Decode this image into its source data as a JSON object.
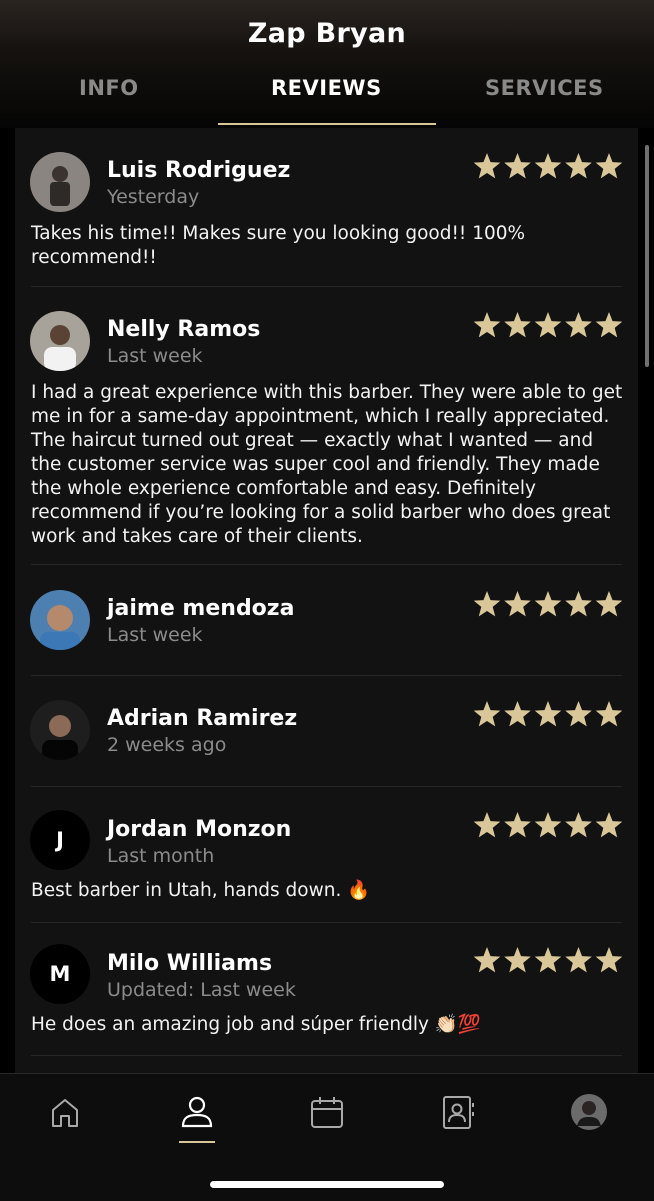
{
  "header": {
    "title": "Zap Bryan"
  },
  "tabs": [
    {
      "label": "INFO"
    },
    {
      "label": "REVIEWS"
    },
    {
      "label": "SERVICES"
    }
  ],
  "reviews": [
    {
      "name": "Luis Rodriguez",
      "time": "Yesterday",
      "rating": 5,
      "text": "Takes his time!! Makes sure you looking good!! 100% recommend!!",
      "avatar": "photo"
    },
    {
      "name": "Nelly Ramos",
      "time": "Last week",
      "rating": 5,
      "text": "I had a great experience with this barber. They were able to get me in for a same-day appointment, which I really appreciated. The haircut turned out great — exactly what I wanted — and the customer service was super cool and friendly. They made the whole experience comfortable and easy. Definitely recommend if you’re looking for a solid barber who does great work and takes care of their clients.",
      "avatar": "photo"
    },
    {
      "name": "jaime mendoza",
      "time": "Last week",
      "rating": 5,
      "text": "",
      "avatar": "photo"
    },
    {
      "name": "Adrian Ramirez",
      "time": "2 weeks ago",
      "rating": 5,
      "text": "",
      "avatar": "photo"
    },
    {
      "name": "Jordan Monzon",
      "time": "Last month",
      "rating": 5,
      "text": "Best barber in Utah, hands down. 🔥",
      "avatar": "J"
    },
    {
      "name": "Milo Williams",
      "time": "Updated: Last week",
      "rating": 5,
      "text": "He does an amazing job and súper friendly 👏🏻💯",
      "avatar": "M"
    }
  ],
  "nav": [
    "home-icon",
    "profile-icon",
    "calendar-icon",
    "contacts-icon",
    "account-avatar"
  ],
  "colors": {
    "accent": "#d9c79a",
    "panel": "#121212",
    "muted": "#8b8b8b"
  }
}
